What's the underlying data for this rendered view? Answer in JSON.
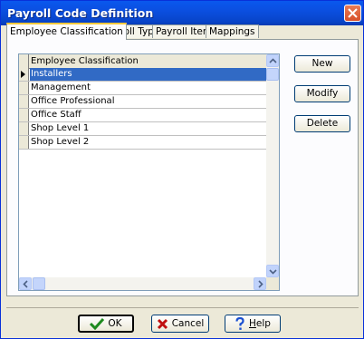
{
  "window": {
    "title": "Payroll Code Definition"
  },
  "tabs": [
    {
      "label": "Employee Classification",
      "active": true
    },
    {
      "label": "Payroll Type",
      "active": false
    },
    {
      "label": "Payroll Items",
      "active": false
    },
    {
      "label": "Mappings",
      "active": false
    }
  ],
  "grid": {
    "column_header": "Employee Classification",
    "rows": [
      "Installers",
      "Management",
      "Office Professional",
      "Office Staff",
      "Shop Level 1",
      "Shop Level 2"
    ],
    "selected_index": 0
  },
  "side_buttons": {
    "new_label": "New",
    "modify_label": "Modify",
    "delete_label": "Delete"
  },
  "dialog_buttons": {
    "ok_label": "OK",
    "cancel_label": "Cancel",
    "help_label": "Help"
  },
  "icons": {
    "close": "close-icon",
    "ok": "checkmark-icon",
    "cancel": "x-icon",
    "help": "question-icon",
    "row_indicator": "triangle-right-icon"
  },
  "colors": {
    "titlebar": "#0a58ee",
    "selection": "#316ac5",
    "active_tab_accent": "#ffc83c",
    "dialog_face": "#ece9d8"
  }
}
